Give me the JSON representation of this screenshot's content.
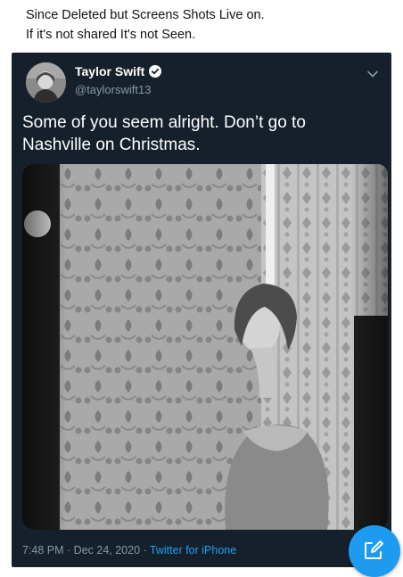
{
  "caption": {
    "line1": "Since Deleted but Screens Shots Live on.",
    "line2": "If it's not shared It's not Seen."
  },
  "tweet": {
    "author_name": "Taylor Swift",
    "handle": "@taylorswift13",
    "text_line1": "Some of you seem alright. Don’t go to",
    "text_line2": "Nashville on Christmas.",
    "time": "7:48 PM",
    "separator": " · ",
    "date": "Dec 24, 2020",
    "source": "Twitter for iPhone"
  },
  "icons": {
    "verified": "verified-badge-icon",
    "more": "chevron-down-icon",
    "compose": "compose-icon"
  },
  "colors": {
    "tweet_bg": "#15202b",
    "accent": "#1d9bf0",
    "secondary_text": "#8899a6"
  }
}
